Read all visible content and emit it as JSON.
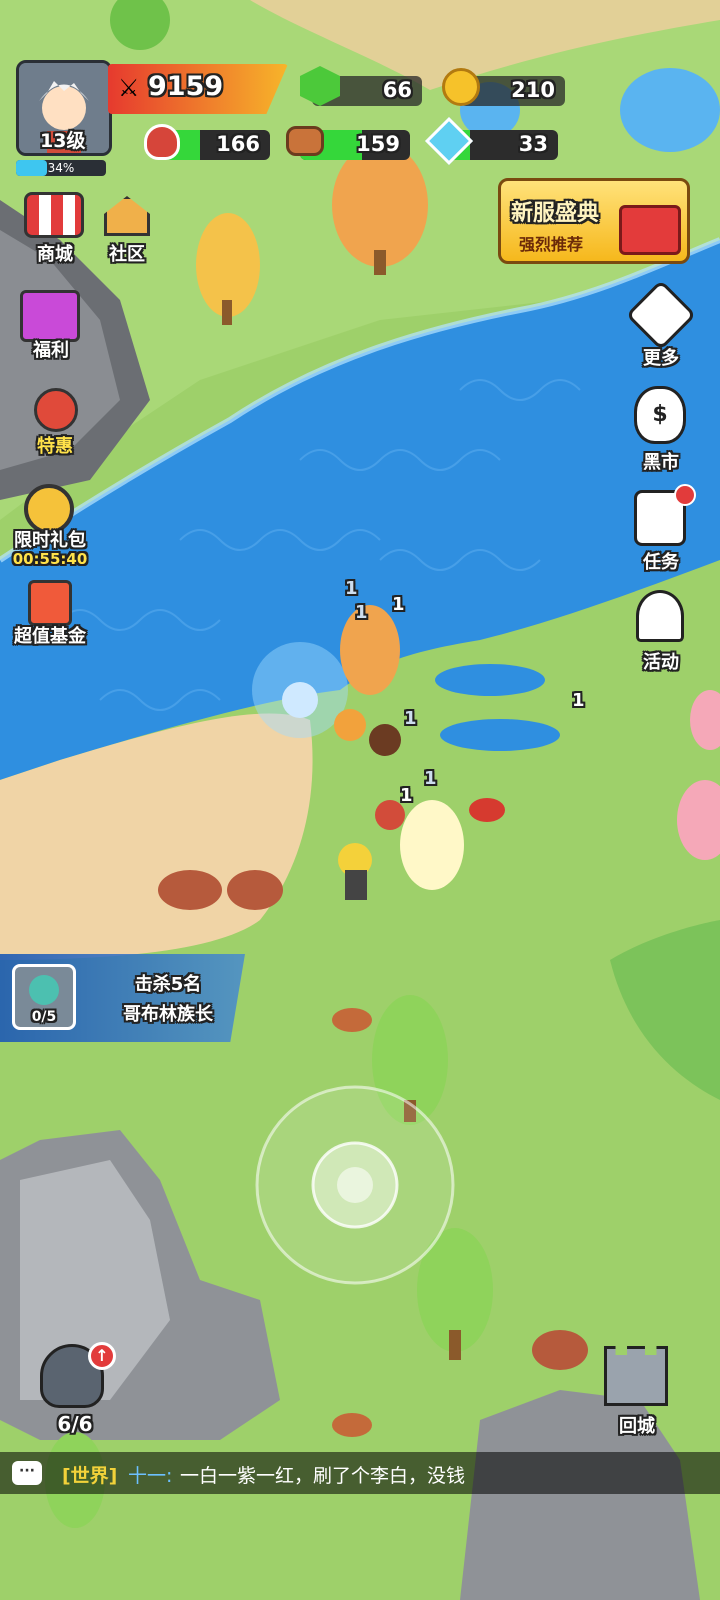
{
  "player": {
    "level": "13级",
    "exp_percent": "34%",
    "power": "9159"
  },
  "resources": {
    "gems": "66",
    "gold": "210",
    "meat": "166",
    "wood": "159",
    "crystal": "33"
  },
  "left_menu": {
    "shop": "商城",
    "community": "社区",
    "welfare": "福利",
    "special": "特惠",
    "limited_pack": "限时礼包",
    "limited_timer": "00:55:40",
    "fund": "超值基金"
  },
  "right_menu": {
    "more": "更多",
    "black_market": "黑市",
    "tasks": "任务",
    "events": "活动"
  },
  "banner": {
    "title": "新服盛典",
    "subtitle": "强烈推荐"
  },
  "quest": {
    "progress": "0/5",
    "line1": "击杀5名",
    "line2": "哥布林族长"
  },
  "bottom": {
    "hero_count": "6/6",
    "return_city": "回城"
  },
  "chat": {
    "channel": "[世界]",
    "sender": "十一:",
    "message": "一白一紫一红，刷了个李白，没钱"
  },
  "damage_numbers": [
    "1",
    "1",
    "1",
    "1",
    "1",
    "1",
    "1"
  ]
}
